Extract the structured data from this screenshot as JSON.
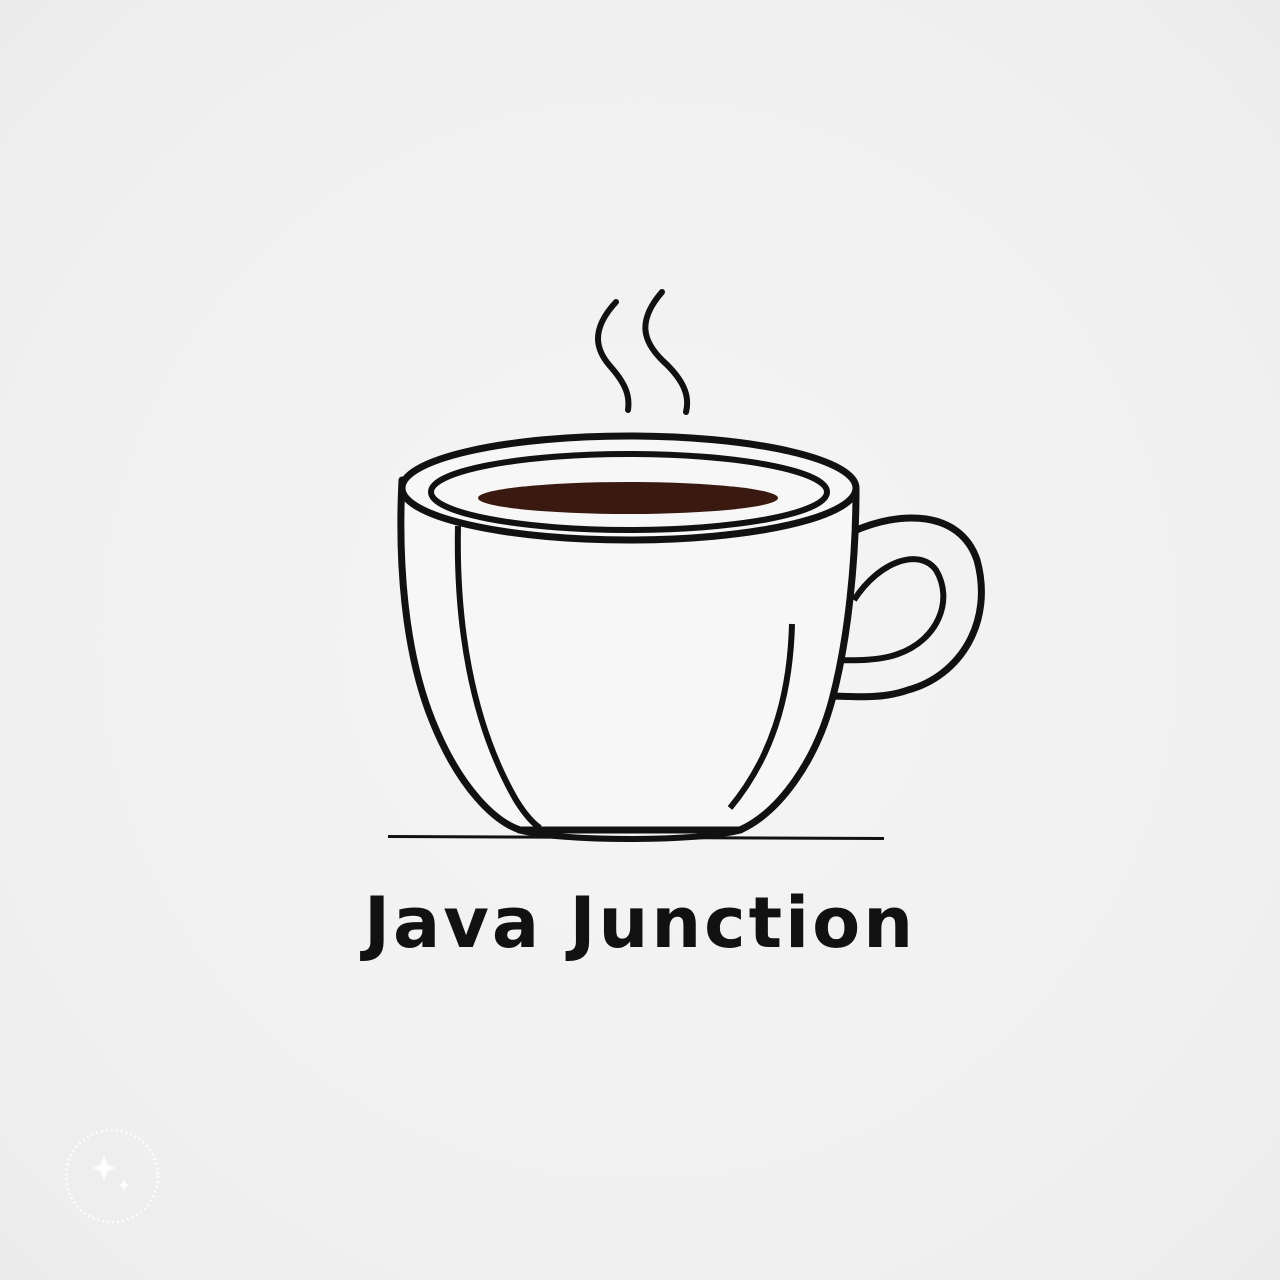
{
  "brand": {
    "name": "Java Junction"
  },
  "icons": {
    "logo": "coffee-cup-icon",
    "steam": "steam-icon",
    "watermark": "sparkle-watermark-icon"
  },
  "colors": {
    "background": "#f2f2f2",
    "line": "#111111",
    "coffee": "#3a1a10",
    "cup_fill": "#f7f7f7"
  }
}
